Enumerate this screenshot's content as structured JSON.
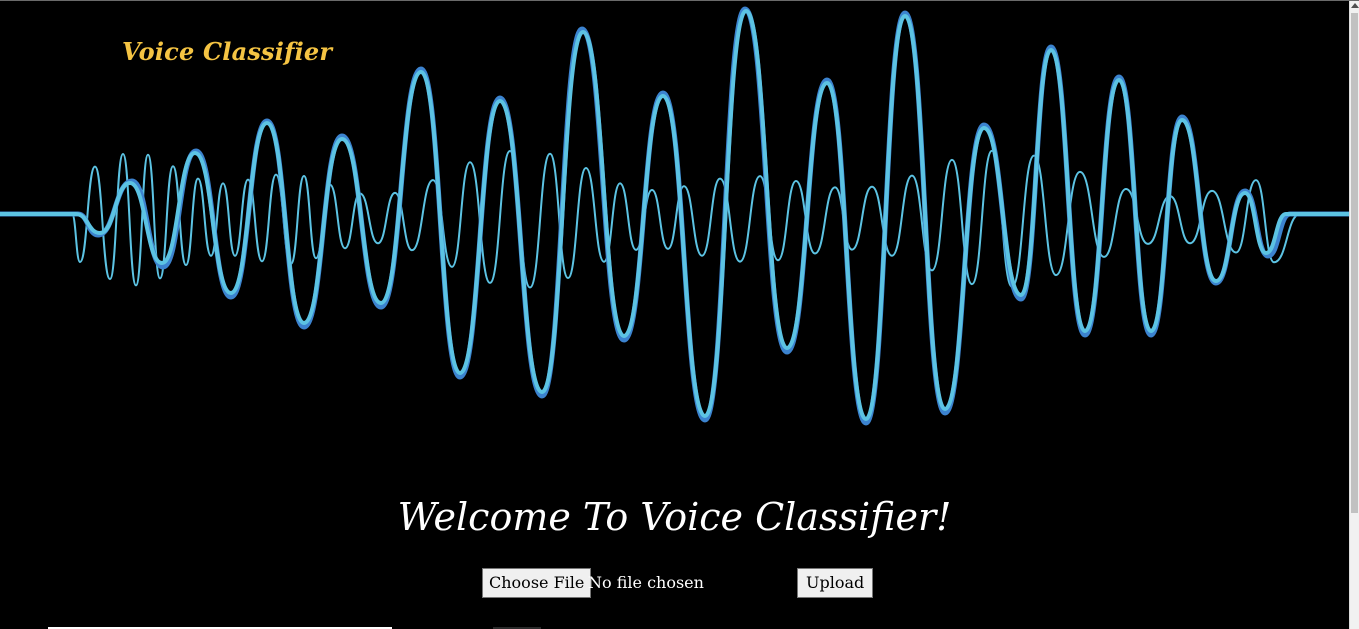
{
  "header": {
    "brand": "Voice Classifier",
    "brand_color": "#f5c443"
  },
  "hero": {
    "waveform_colors": [
      "#3c83cf",
      "#5cc3e3"
    ]
  },
  "main": {
    "welcome_title": "Welcome To Voice Classifier!",
    "upload_form": {
      "choose_label": "Choose File",
      "file_status": "No file chosen",
      "upload_label": "Upload"
    }
  }
}
